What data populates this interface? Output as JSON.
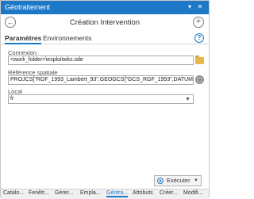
{
  "window": {
    "title": "Géotraitement",
    "pin_icon": "pin-icon",
    "close_icon": "close-icon"
  },
  "tool": {
    "title": "Création Intervention",
    "back_icon": "back-arrow-icon",
    "add_icon": "add-icon"
  },
  "tabs": {
    "parameters": "Paramètres",
    "environments": "Environnements",
    "help_icon": "help-icon"
  },
  "params": {
    "connexion": {
      "label": "Connexion",
      "value": "<work_folder>\\exploitwks.sde"
    },
    "spatial_ref": {
      "label": "Référence spatiale",
      "value": "PROJCS[\"RGF_1993_Lambert_93\",GEOGCS[\"GCS_RGF_1993\",DATUM[\"D_RGF_"
    },
    "local": {
      "label": "Local",
      "value": "fr"
    }
  },
  "run": {
    "label": "Exécuter"
  },
  "bottom_tabs": [
    "Catalo...",
    "Fenêtr...",
    "Gérer...",
    "Empla...",
    "Géotra...",
    "Attributs",
    "Créer...",
    "Modifi..."
  ],
  "colors": {
    "accent": "#1e78c8",
    "folder": "#e6b84a"
  }
}
